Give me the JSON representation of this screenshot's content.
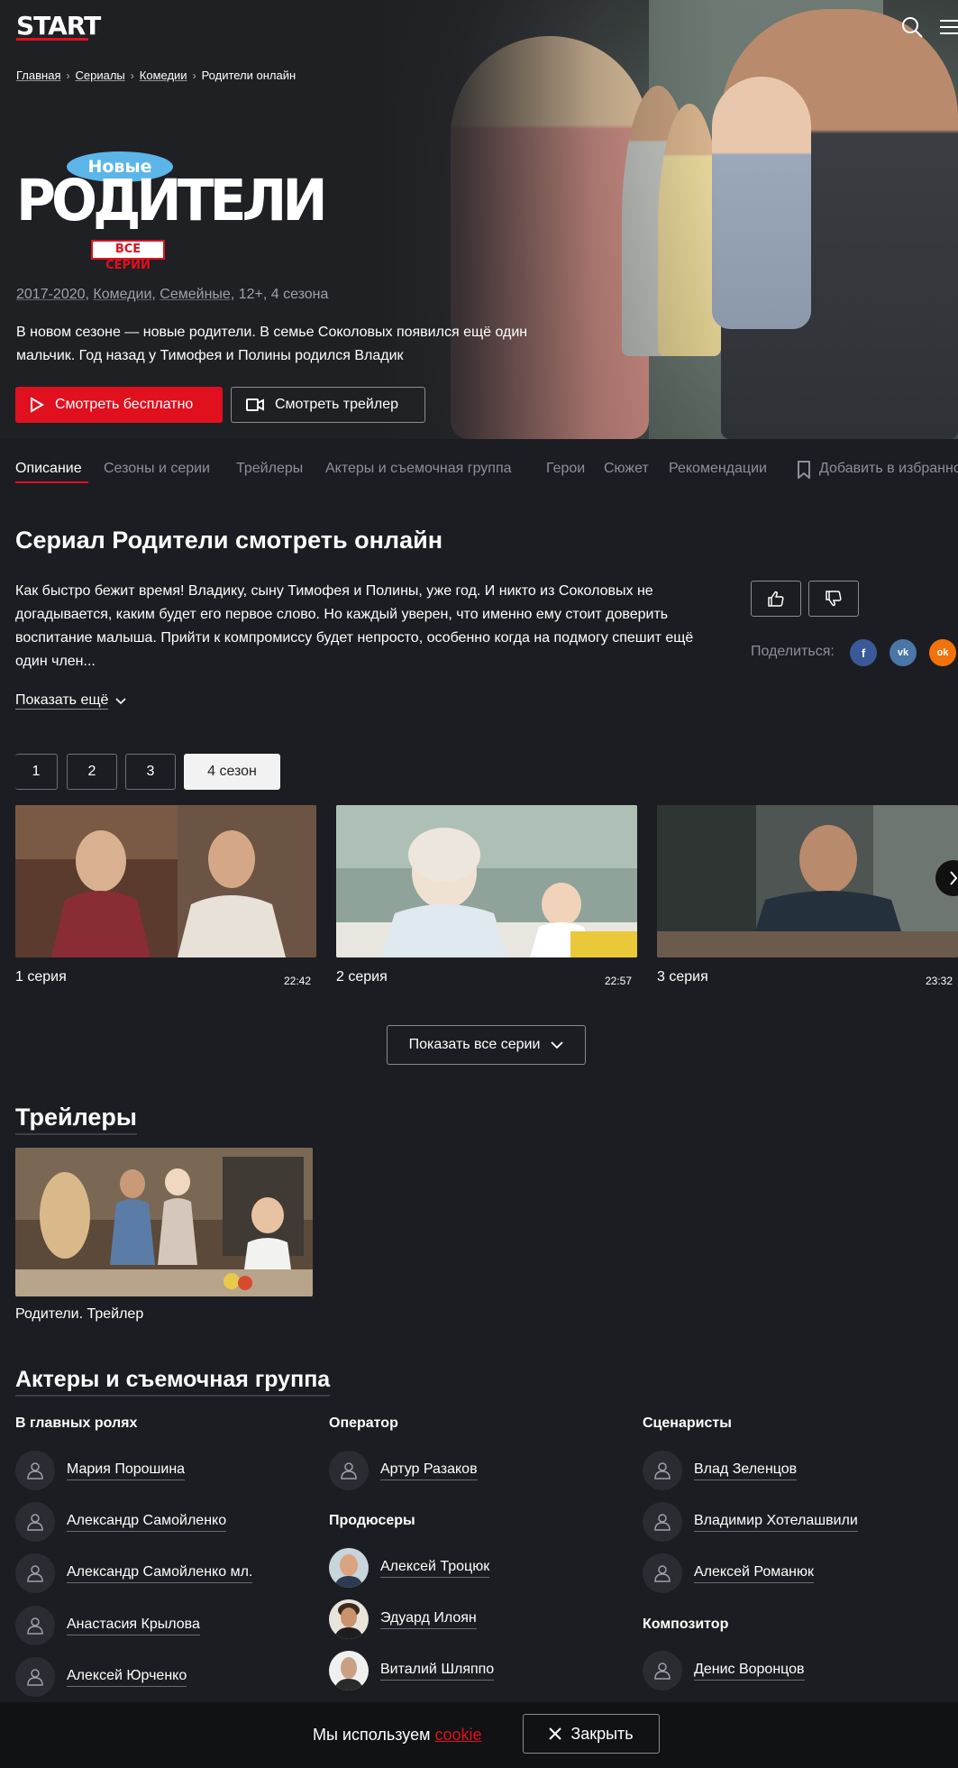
{
  "header": {
    "logo": "START"
  },
  "breadcrumb": [
    "Главная",
    "Сериалы",
    "Комедии",
    "Родители онлайн"
  ],
  "hero": {
    "logo_top": "Новые",
    "logo_main": "РОДИТЕЛИ",
    "logo_badge": "ВСЕ СЕРИИ",
    "meta": [
      "2017-2020",
      "Комедии",
      "Семейные",
      "12+",
      "4 сезона"
    ],
    "description": "В новом сезоне — новые родители. В семье Соколовых появился ещё один мальчик. Год назад у Тимофея и Полины родился Владик",
    "watch_label": "Смотреть бесплатно",
    "trailer_label": "Смотреть трейлер"
  },
  "tabs": [
    "Описание",
    "Сезоны и серии",
    "Трейлеры",
    "Актеры и съемочная группа",
    "Герои",
    "Сюжет",
    "Рекомендации",
    "Добавить в избранное"
  ],
  "about": {
    "title": "Сериал Родители смотреть онлайн",
    "text": "Как быстро бежит время! Владику, сыну Тимофея и Полины, уже год. И никто из Соколовых не догадывается, каким будет его первое слово. Но каждый уверен, что именно ему стоит доверить воспитание малыша. Прийти к компромиссу будет непросто, особенно когда на подмогу спешит ещё один член...",
    "show_more": "Показать ещё",
    "share_label": "Поделиться:"
  },
  "share": [
    "f",
    "vk",
    "ok"
  ],
  "seasons": [
    "1",
    "2",
    "3",
    "4 сезон"
  ],
  "episodes": [
    {
      "title": "1 серия",
      "duration": "22:42"
    },
    {
      "title": "2 серия",
      "duration": "22:57"
    },
    {
      "title": "3 серия",
      "duration": "23:32"
    }
  ],
  "show_all_label": "Показать все серии",
  "trailers": {
    "title": "Трейлеры",
    "items": [
      {
        "title": "Родители. Трейлер"
      }
    ]
  },
  "crew": {
    "title": "Актеры и съемочная группа",
    "main_roles": {
      "label": "В главных ролях",
      "people": [
        "Мария Порошина",
        "Александр Самойленко",
        "Александр Самойленко мл.",
        "Анастасия Крылова",
        "Алексей Юрченко"
      ]
    },
    "operator": {
      "label": "Оператор",
      "people": [
        "Артур Разаков"
      ]
    },
    "producers": {
      "label": "Продюсеры",
      "people": [
        "Алексей Троцюк",
        "Эдуард Илоян",
        "Виталий Шляппо"
      ]
    },
    "writers": {
      "label": "Сценаристы",
      "people": [
        "Влад Зеленцов",
        "Владимир Хотелашвили",
        "Алексей Романюк"
      ]
    },
    "composer": {
      "label": "Композитор",
      "people": [
        "Денис Воронцов"
      ]
    }
  },
  "cookie": {
    "text": "Мы используем",
    "link": "cookie",
    "close_label": "Закрыть"
  },
  "colors": {
    "accent": "#e0101f",
    "background": "#1c1d22",
    "muted": "#8d9098"
  }
}
